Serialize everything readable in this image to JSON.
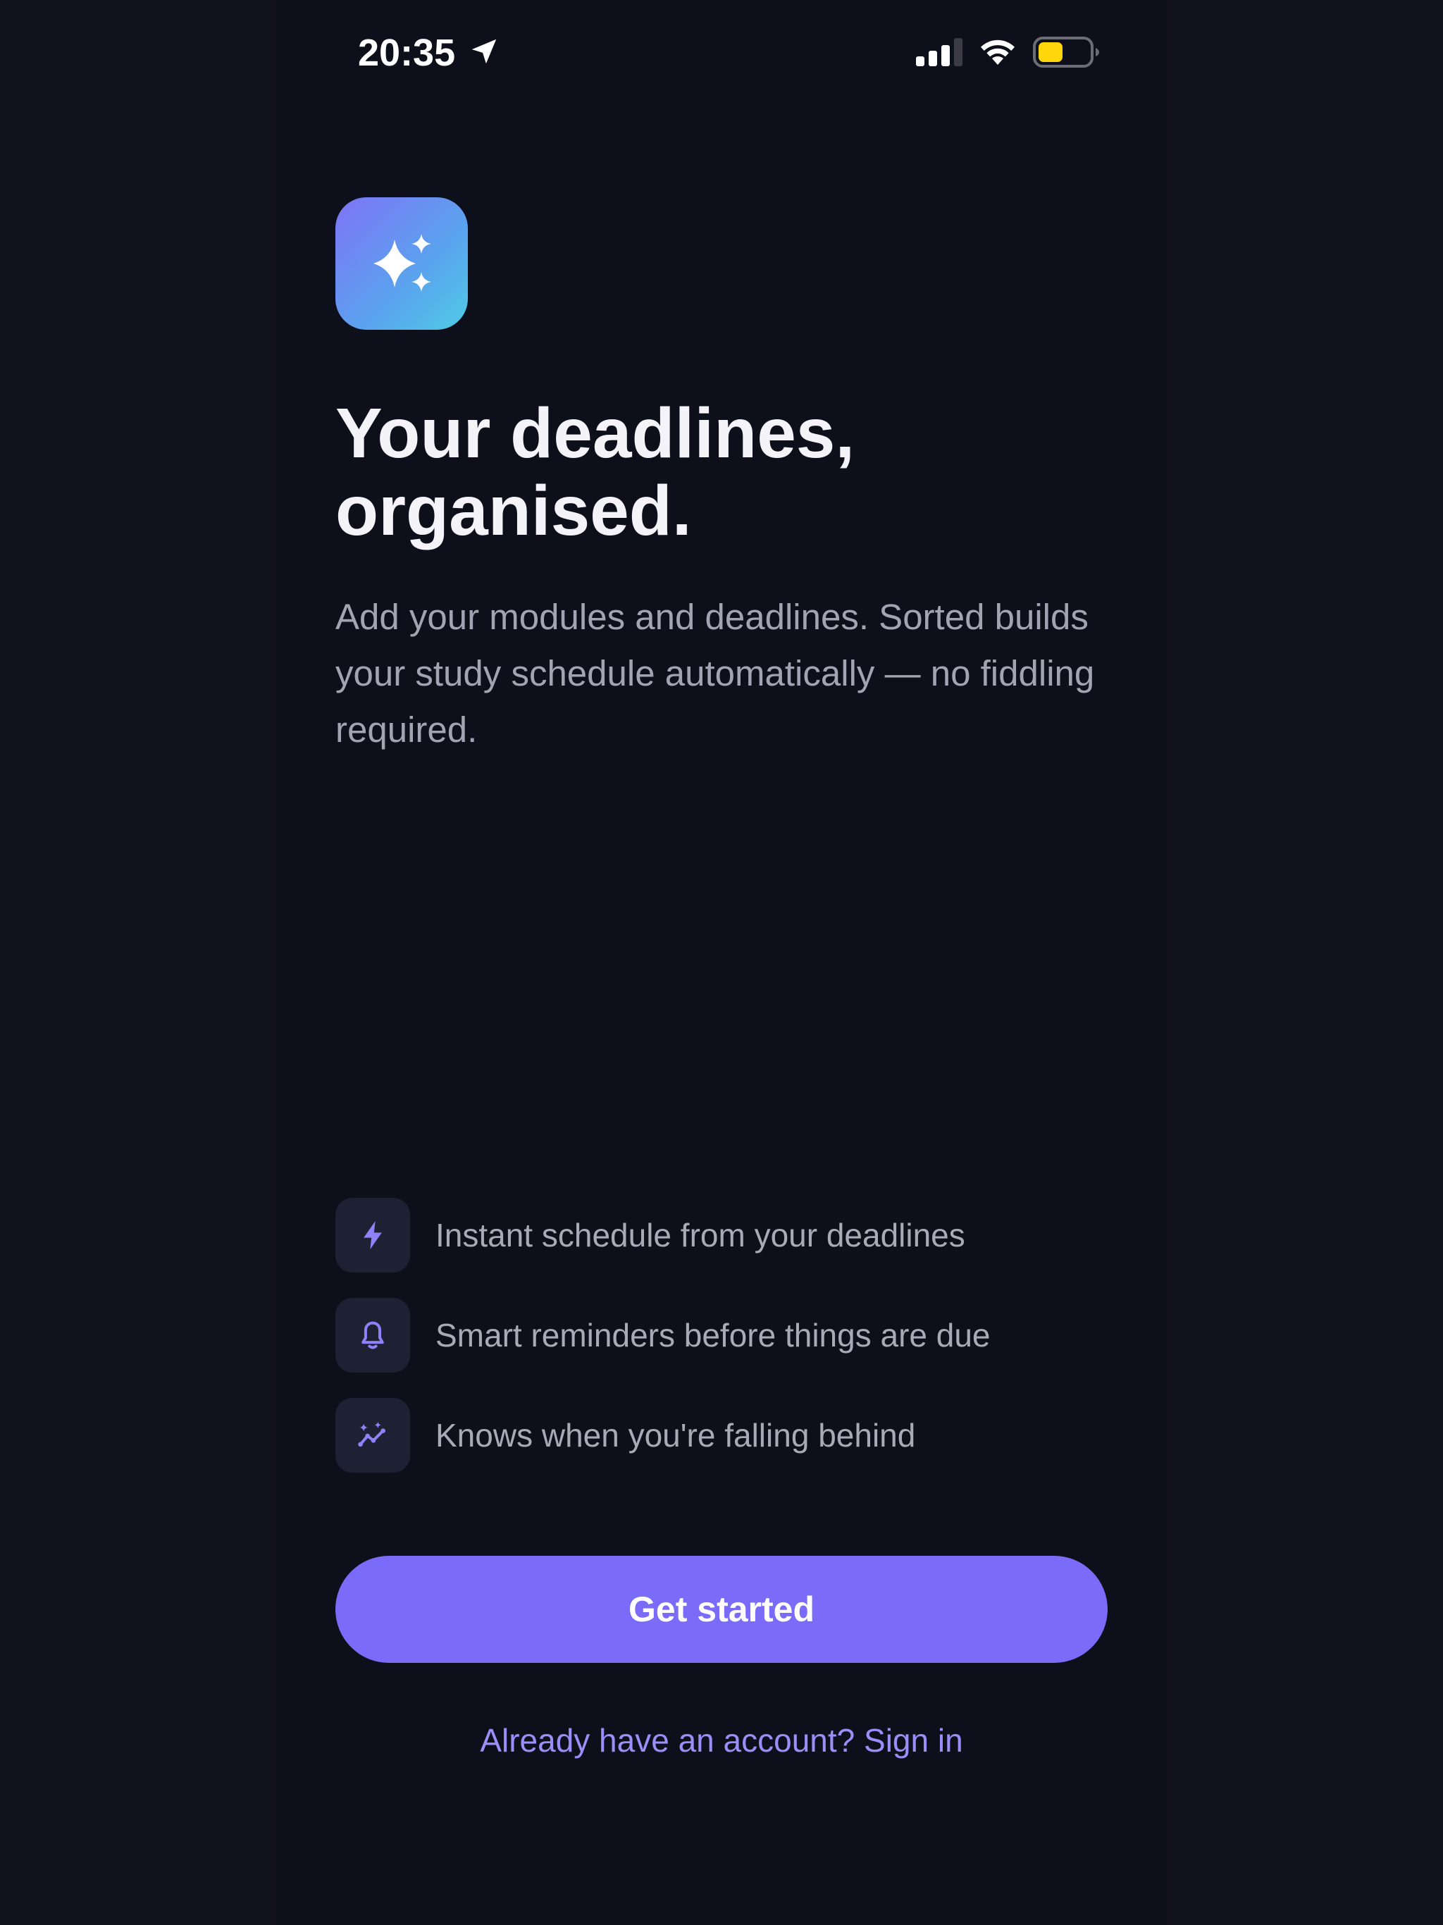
{
  "status_bar": {
    "time": "20:35",
    "location_icon": "location-arrow-icon",
    "signal_icon": "cellular-signal-icon",
    "wifi_icon": "wifi-icon",
    "battery_icon": "battery-low-power-icon",
    "battery_color": "#ffd60a"
  },
  "hero": {
    "app_icon": "sparkles-icon",
    "headline_line1": "Your deadlines,",
    "headline_line2": "organised.",
    "subtitle": "Add your modules and deadlines. Sorted builds your study schedule automatically — no fiddling required."
  },
  "features": [
    {
      "icon": "lightning-bolt-icon",
      "label": "Instant schedule from your deadlines"
    },
    {
      "icon": "bell-icon",
      "label": "Smart reminders before things are due"
    },
    {
      "icon": "trend-sparkle-icon",
      "label": "Knows when you're falling behind"
    }
  ],
  "actions": {
    "primary_label": "Get started",
    "secondary_label": "Already have an account? Sign in"
  },
  "colors": {
    "background": "#0d0f1a",
    "accent": "#7a6cf9",
    "link": "#9b8ef9",
    "icon_gradient_start": "#7e74f6",
    "icon_gradient_end": "#4fcbe6"
  }
}
